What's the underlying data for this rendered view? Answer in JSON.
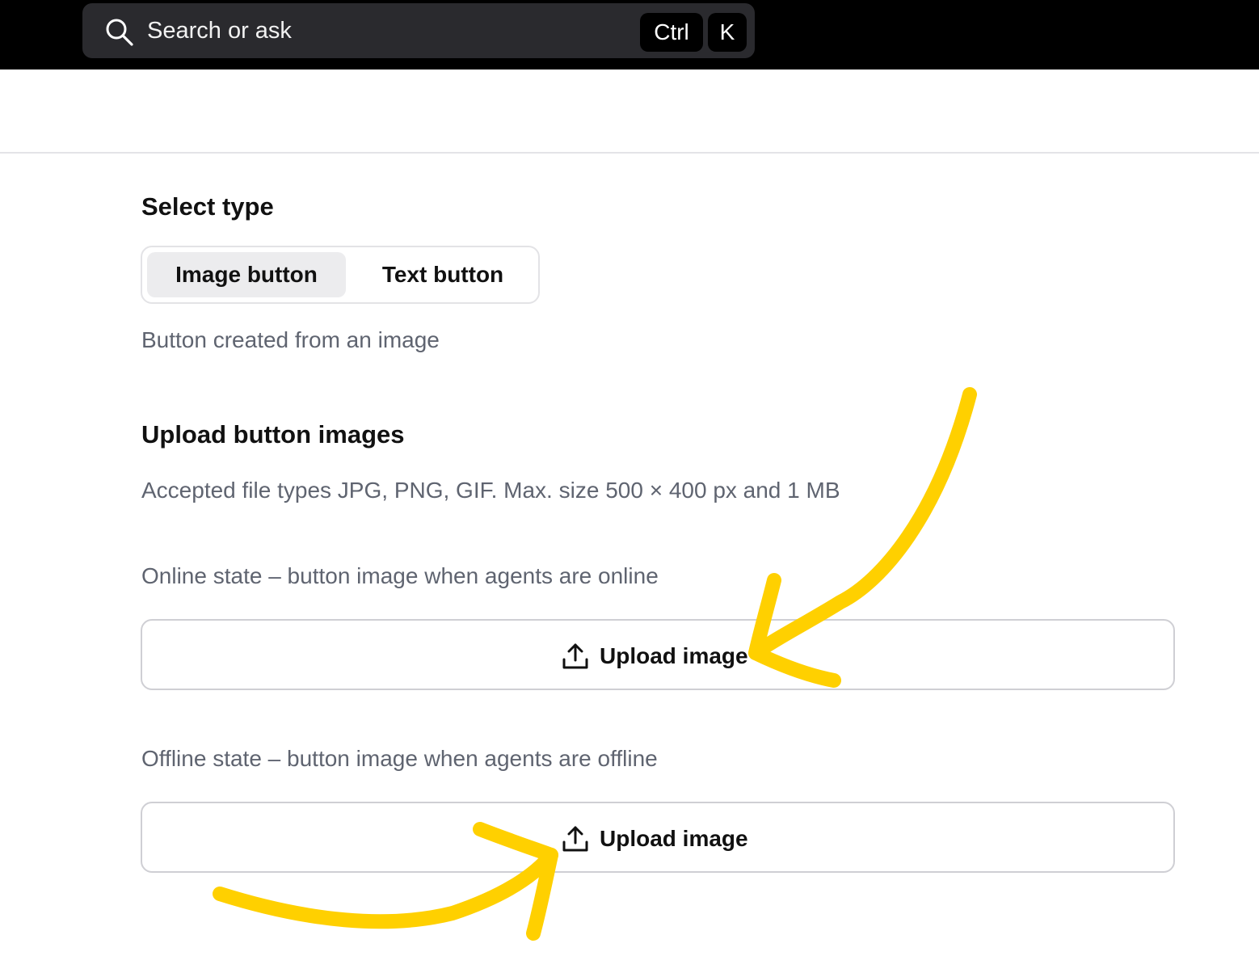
{
  "search": {
    "placeholder": "Search or ask",
    "shortcut_keys": [
      "Ctrl",
      "K"
    ]
  },
  "select_type": {
    "title": "Select type",
    "options": [
      {
        "label": "Image button",
        "selected": true
      },
      {
        "label": "Text button",
        "selected": false
      }
    ],
    "description": "Button created from an image"
  },
  "upload_images": {
    "title": "Upload button images",
    "accepted_types": "Accepted file types JPG, PNG, GIF. Max. size 500 × 400 px and 1 MB",
    "online": {
      "label": "Online state – button image when agents are online",
      "button_label": "Upload image"
    },
    "offline": {
      "label": "Offline state – button image when agents are offline",
      "button_label": "Upload image"
    }
  },
  "colors": {
    "topbar": "#000000",
    "search_bg": "#2a2a2e",
    "annotation_arrow": "#FFD000",
    "muted_text": "#5f6470"
  },
  "icons": {
    "search": "search-icon",
    "upload": "upload-icon"
  }
}
